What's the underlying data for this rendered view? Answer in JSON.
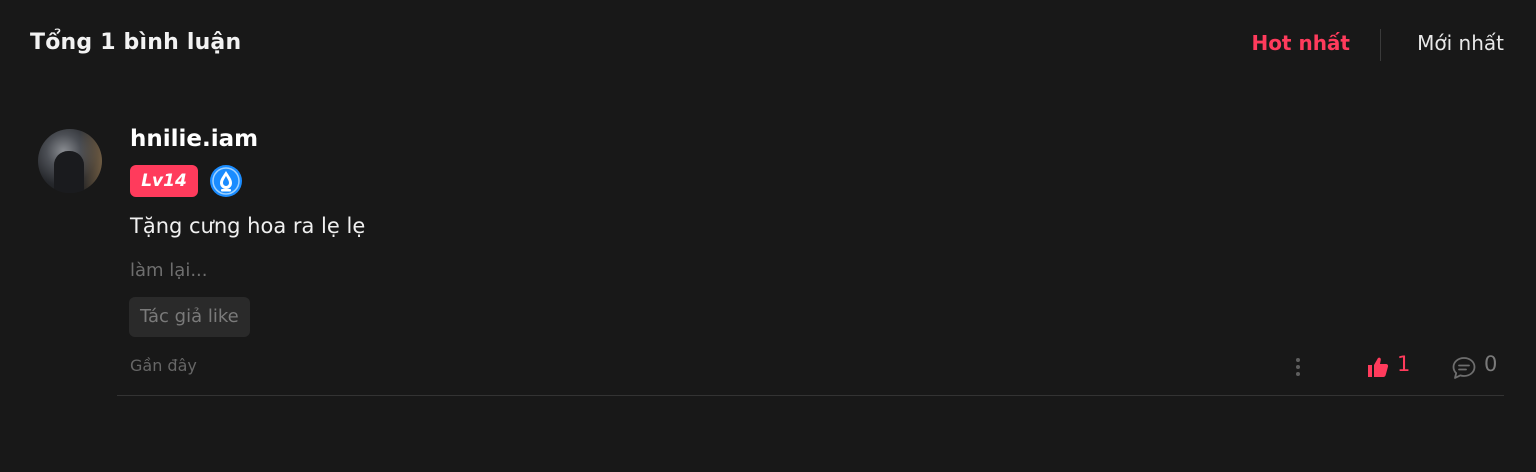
{
  "header": {
    "title": "Tổng 1 bình luận",
    "sort_hot": "Hot nhất",
    "sort_new": "Mới nhất"
  },
  "colors": {
    "accent": "#ff3b5c",
    "background": "#181818",
    "vip_badge": "#1a8cff"
  },
  "comment": {
    "username": "hnilie.iam",
    "level": "Lv14",
    "vip_icon": "water-drop-badge-icon",
    "text": "Tặng cưng hoa ra lẹ lẹ",
    "reply_preview": "làm lại...",
    "author_like_tag": "Tác giả like",
    "time": "Gần đây",
    "likes": "1",
    "replies": "0"
  }
}
